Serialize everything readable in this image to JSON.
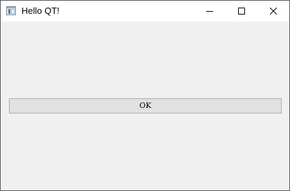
{
  "window": {
    "title": "Hello QT!",
    "icon": "qt-app-window-icon",
    "controls": {
      "minimize_icon": "minimize-icon",
      "maximize_icon": "maximize-icon",
      "close_icon": "close-icon"
    }
  },
  "content": {
    "ok_button_label": "OK"
  },
  "colors": {
    "titlebar": "#ffffff",
    "client_background": "#f0f0f0",
    "button_face": "#e1e1e1",
    "button_border": "#adadad",
    "window_border": "#5a5a5a"
  }
}
